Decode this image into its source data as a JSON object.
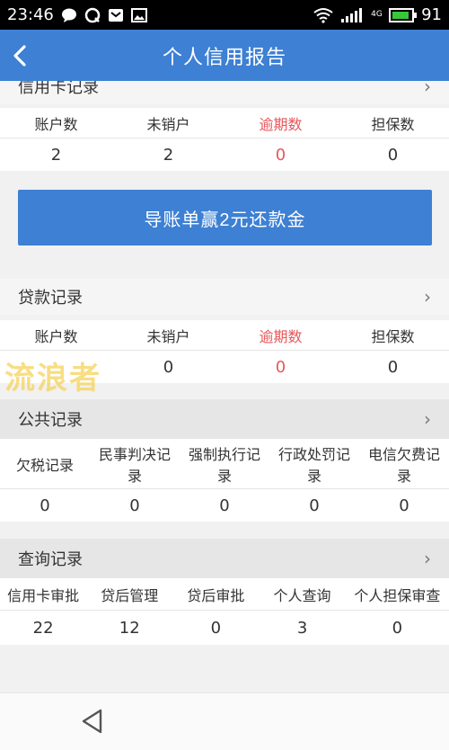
{
  "status_bar": {
    "time": "23:46",
    "battery": "91",
    "network": "4G"
  },
  "app_bar": {
    "title": "个人信用报告"
  },
  "credit_card": {
    "title": "信用卡记录",
    "headers": [
      "账户数",
      "未销户",
      "逾期数",
      "担保数"
    ],
    "values": [
      "2",
      "2",
      "0",
      "0"
    ]
  },
  "promo_button": {
    "label": "导账单赢2元还款金"
  },
  "loan": {
    "title": "贷款记录",
    "headers": [
      "账户数",
      "未销户",
      "逾期数",
      "担保数"
    ],
    "values": [
      "",
      "0",
      "0",
      "0"
    ]
  },
  "watermark": "流浪者",
  "public": {
    "title": "公共记录",
    "headers": [
      "欠税记录",
      "民事判决记录",
      "强制执行记录",
      "行政处罚记录",
      "电信欠费记录"
    ],
    "values": [
      "0",
      "0",
      "0",
      "0",
      "0"
    ]
  },
  "query": {
    "title": "查询记录",
    "headers": [
      "信用卡审批",
      "贷后管理",
      "贷后审批",
      "个人查询",
      "个人担保审查"
    ],
    "values": [
      "22",
      "12",
      "0",
      "3",
      "0"
    ]
  },
  "colors": {
    "accent": "#3d80d4",
    "overdue": "#e8575a"
  }
}
